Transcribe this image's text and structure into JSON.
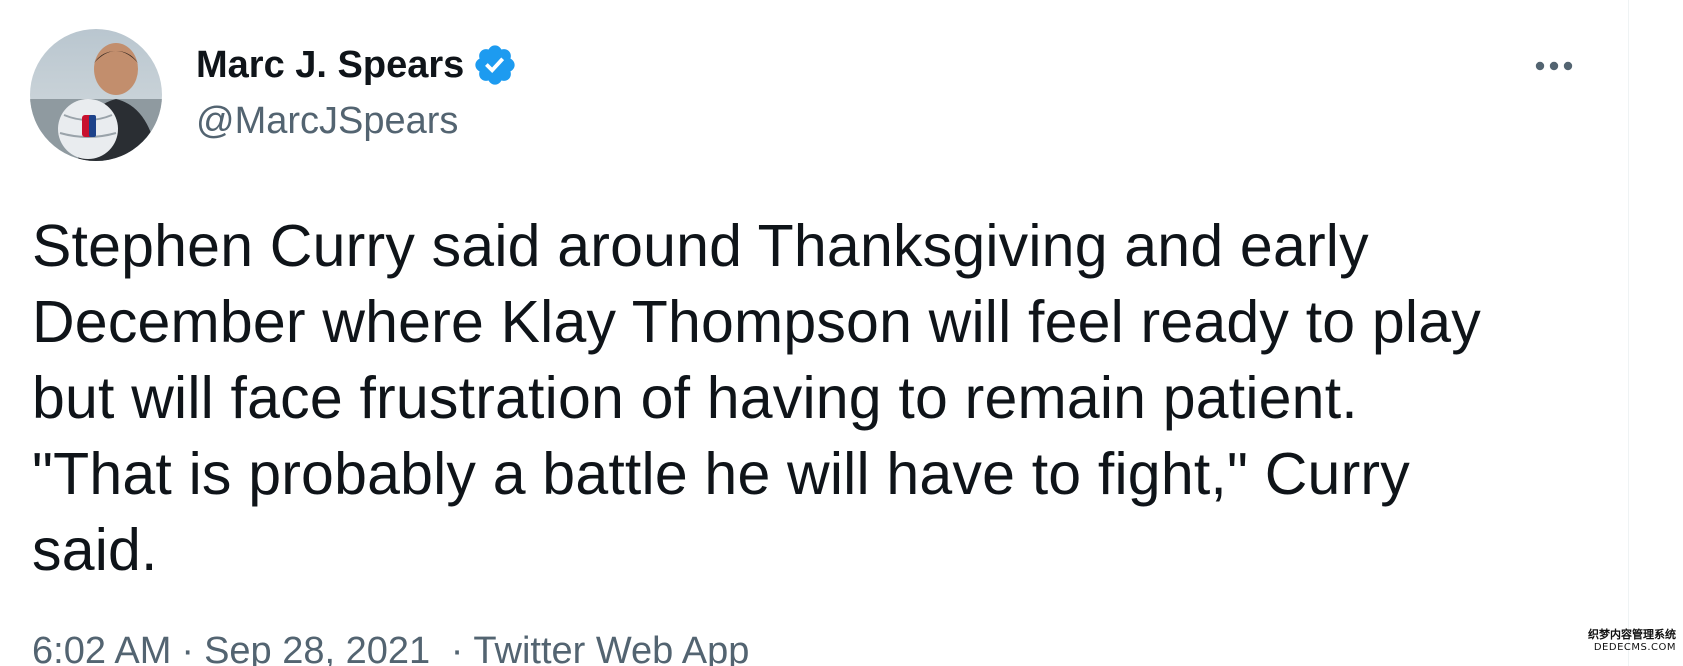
{
  "tweet": {
    "author": {
      "display_name": "Marc J. Spears",
      "handle": "@MarcJSpears",
      "verified_icon": "verified-badge-icon"
    },
    "more_icon": "more-dots-icon",
    "text": "Stephen Curry said around Thanksgiving and early\nDecember where Klay Thompson will feel ready to play\nbut will face frustration of having to remain patient.\n\"That is probably a battle he will have to fight,\" Curry\nsaid.",
    "meta": {
      "time": "6:02 AM",
      "separator": "·",
      "date": "Sep 28, 2021",
      "source": "Twitter Web App"
    }
  },
  "watermark": {
    "line1": "织梦内容管理系统",
    "line2": "DEDECMS.COM"
  },
  "colors": {
    "text_primary": "#0f1419",
    "text_secondary": "#536471",
    "verified_blue": "#1d9bf0",
    "border": "#eff3f4"
  }
}
